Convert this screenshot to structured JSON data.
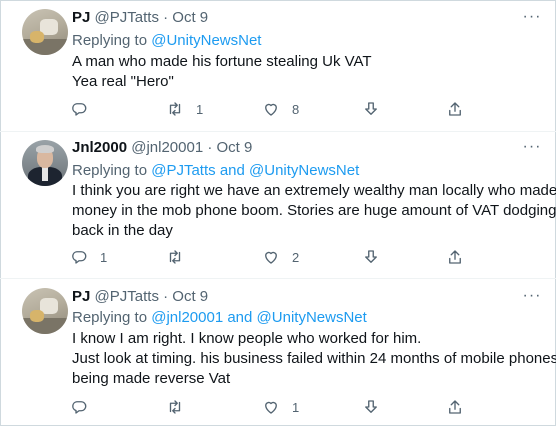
{
  "tweets": [
    {
      "name": "PJ",
      "handle": "@PJTatts",
      "dot": "·",
      "date": "Oct 9",
      "replying_prefix": "Replying to",
      "mention1": "@UnityNewsNet",
      "and_word": "",
      "mention2": "",
      "lines": [
        "A man who made his fortune stealing Uk VAT",
        "Yea real \"Hero\""
      ],
      "reply_count": "",
      "retweet_count": "1",
      "like_count": "8",
      "avatar": "pj-avatar"
    },
    {
      "name": "Jnl2000",
      "handle": "@jnl20001",
      "dot": "·",
      "date": "Oct 9",
      "replying_prefix": "Replying to",
      "mention1": "@PJTatts",
      "and_word": "and",
      "mention2": "@UnityNewsNet",
      "lines": [
        "I think you are right we have an extremely wealthy man locally who made his",
        "money in the mob phone boom. Stories are huge amount of VAT dodging",
        "back in the day"
      ],
      "reply_count": "1",
      "retweet_count": "",
      "like_count": "2",
      "avatar": "jnl-avatar"
    },
    {
      "name": "PJ",
      "handle": "@PJTatts",
      "dot": "·",
      "date": "Oct 9",
      "replying_prefix": "Replying to",
      "mention1": "@jnl20001",
      "and_word": "and",
      "mention2": "@UnityNewsNet",
      "lines": [
        "I know I am right. I know people who worked for him.",
        "Just look at timing. his business failed within 24 months of mobile phones",
        "being made reverse Vat"
      ],
      "reply_count": "",
      "retweet_count": "",
      "like_count": "1",
      "avatar": "pj-avatar"
    }
  ],
  "icons": [
    "more-icon",
    "reply-icon",
    "retweet-icon",
    "like-icon",
    "share-icon",
    "upload-icon"
  ],
  "colors": {
    "text": "#0f1419",
    "secondary": "#536471",
    "link": "#1d9bf0",
    "divider": "#eff3f4"
  }
}
